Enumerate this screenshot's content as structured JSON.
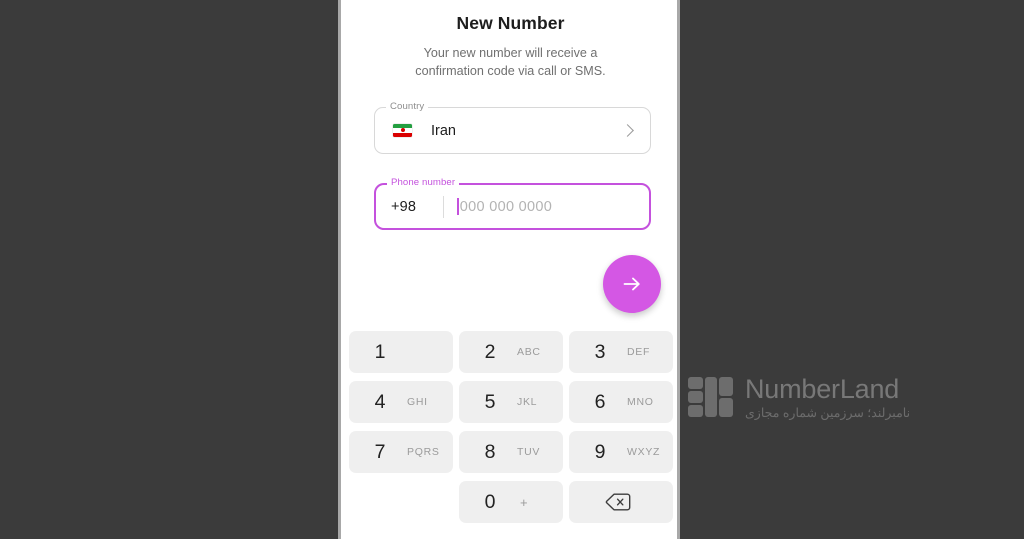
{
  "screen": {
    "title": "New Number",
    "subtitle": "Your new number will receive a confirmation code via call or SMS.",
    "background_color": "#3b3b3b",
    "panel_color": "#ffffff",
    "accent_color": "#c451dd"
  },
  "country_field": {
    "label": "Country",
    "flag_icon": "iran-flag-icon",
    "value": "Iran",
    "chevron": "chevron-right-icon"
  },
  "phone_field": {
    "label": "Phone number",
    "dial_code": "+98",
    "value": "",
    "placeholder": "000 000 0000",
    "focused": true,
    "accent_color": "#c451dd"
  },
  "next_button": {
    "icon": "arrow-right-icon",
    "color": "#d457e4",
    "label": ""
  },
  "keypad": {
    "keys": [
      {
        "digit": "1",
        "letters": "",
        "name": "key-1"
      },
      {
        "digit": "2",
        "letters": "ABC",
        "name": "key-2"
      },
      {
        "digit": "3",
        "letters": "DEF",
        "name": "key-3"
      },
      {
        "digit": "4",
        "letters": "GHI",
        "name": "key-4"
      },
      {
        "digit": "5",
        "letters": "JKL",
        "name": "key-5"
      },
      {
        "digit": "6",
        "letters": "MNO",
        "name": "key-6"
      },
      {
        "digit": "7",
        "letters": "PQRS",
        "name": "key-7"
      },
      {
        "digit": "8",
        "letters": "TUV",
        "name": "key-8"
      },
      {
        "digit": "9",
        "letters": "WXYZ",
        "name": "key-9"
      },
      {
        "digit": "",
        "letters": "",
        "name": "key-blank"
      },
      {
        "digit": "0",
        "letters": "+",
        "name": "key-0"
      },
      {
        "digit": "",
        "letters": "",
        "name": "key-backspace"
      }
    ]
  },
  "watermark": {
    "wordmark": "NumberLand",
    "subtitle": "نامبرلند؛ سرزمین شماره مجازی",
    "color": "#9e9e9e"
  }
}
